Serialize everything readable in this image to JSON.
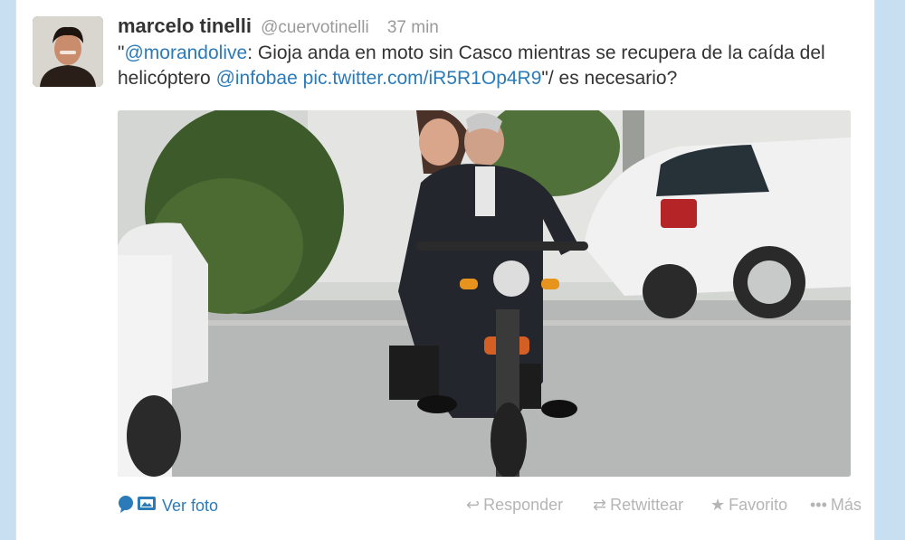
{
  "tweet": {
    "name": "marcelo tinelli",
    "handle": "@cuervotinelli",
    "time": "37 min",
    "open_quote": "\"",
    "mention": "@morandolive",
    "body_part1": ": Gioja anda en moto sin Casco mientras se recupera de la caída del helicóptero ",
    "mention2": "@infobae",
    "link": "pic.twitter.com/iR5R1Op4R9",
    "body_part2": "\"/ es necesario?"
  },
  "actions": {
    "view_photo": "Ver foto",
    "reply": "Responder",
    "retweet": "Retwittear",
    "favorite": "Favorito",
    "more": "Más"
  },
  "colors": {
    "link": "#2b7bb9",
    "text": "#333333",
    "muted": "#9a9a9a",
    "background": "#c7dff0"
  }
}
